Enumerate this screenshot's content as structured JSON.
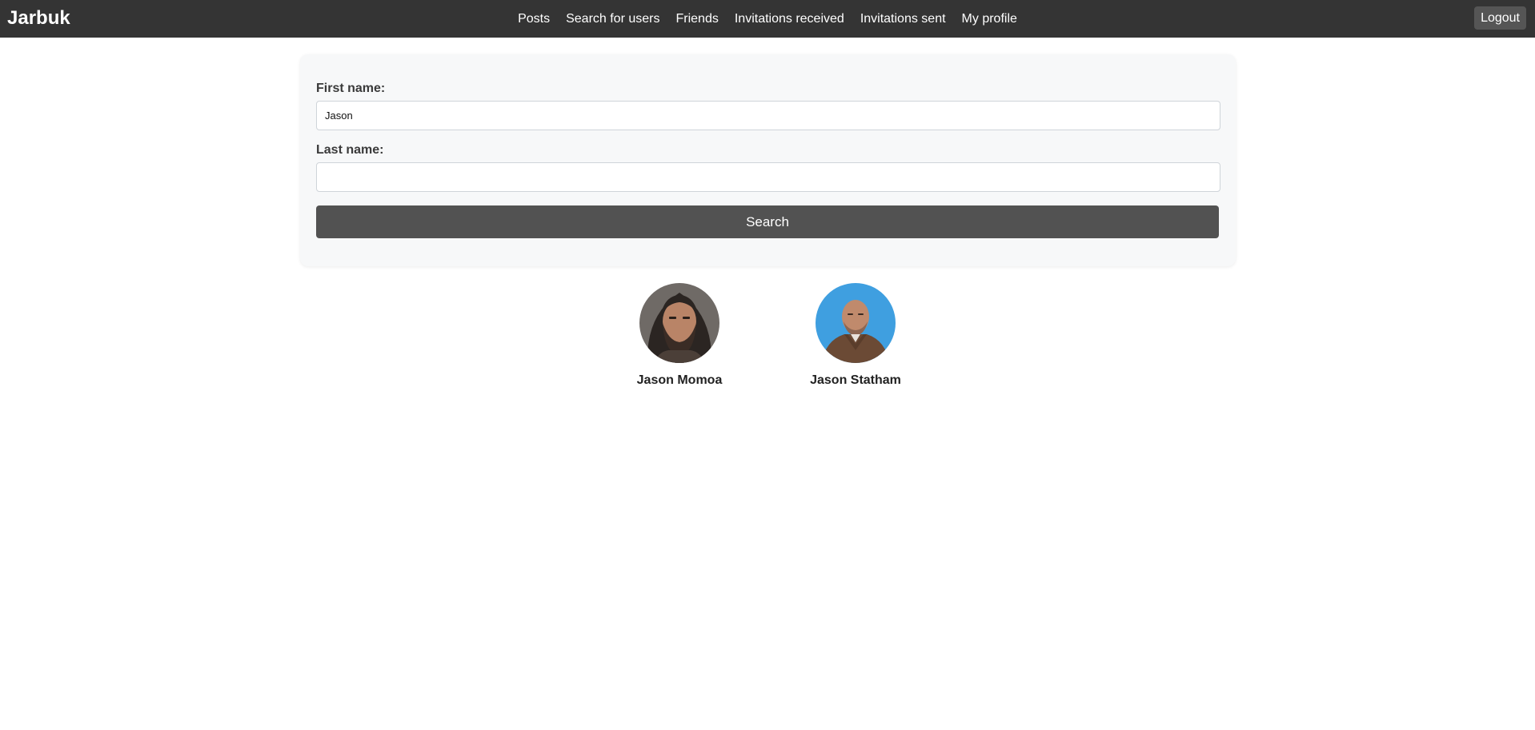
{
  "app": {
    "brand": "Jarbuk"
  },
  "nav": {
    "items": [
      {
        "label": "Posts"
      },
      {
        "label": "Search for users"
      },
      {
        "label": "Friends"
      },
      {
        "label": "Invitations received"
      },
      {
        "label": "Invitations sent"
      },
      {
        "label": "My profile"
      }
    ],
    "logout_label": "Logout"
  },
  "search": {
    "first_name_label": "First name:",
    "first_name_value": "Jason",
    "last_name_label": "Last name:",
    "last_name_value": "",
    "button_label": "Search"
  },
  "results": [
    {
      "name": "Jason Momoa",
      "avatar": "long-haired-bearded-man-portrait"
    },
    {
      "name": "Jason Statham",
      "avatar": "bald-man-portrait-blue-background"
    }
  ],
  "colors": {
    "navbar": "#343434",
    "button": "#525252",
    "card": "#f7f8f9"
  }
}
